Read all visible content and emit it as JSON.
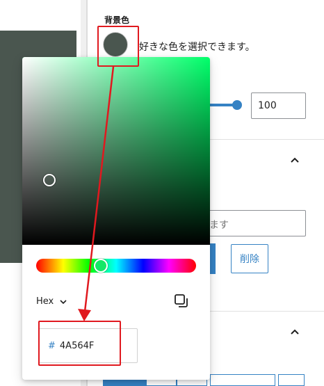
{
  "sidebar": {
    "background_color_label": "背景色",
    "swatch_color": "#4A564F",
    "choose_color_text": "好きな色を選択できます。",
    "opacity_value": "100",
    "text_input_visible_placeholder": "ます",
    "delete_label": "削除"
  },
  "color_picker": {
    "format_label": "Hex",
    "hex_prefix": "#",
    "hex_value": "4A564F",
    "hue_color": "#00ff6a"
  },
  "annotation": {
    "color": "#e0191f"
  }
}
